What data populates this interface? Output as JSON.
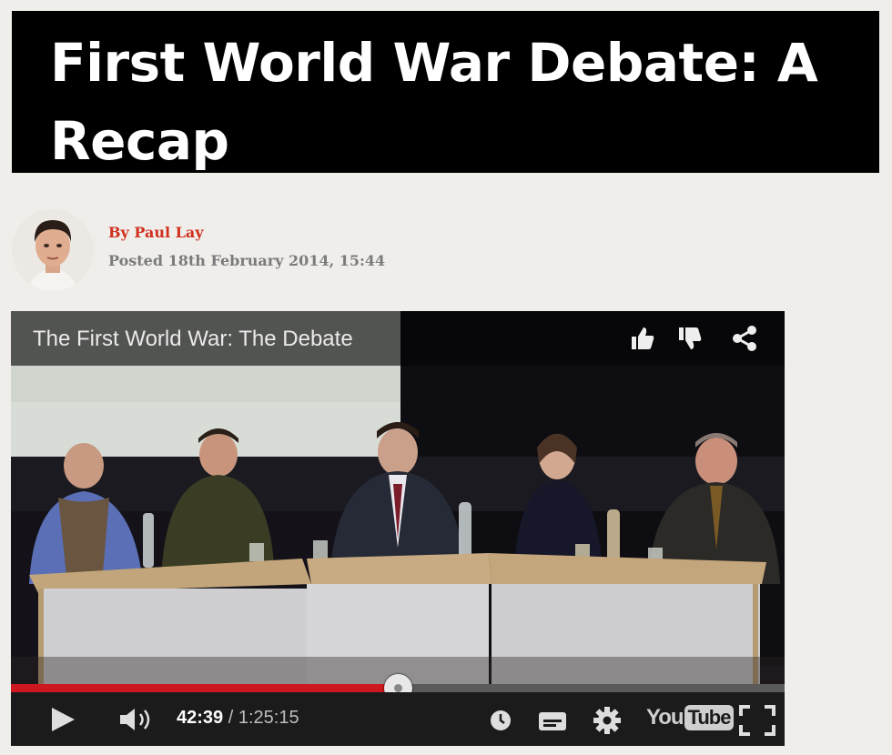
{
  "article": {
    "title": "First World War Debate: A Recap",
    "byline": "By Paul Lay",
    "posted": "Posted 18th February 2014, 15:44"
  },
  "video": {
    "title": "The First World War: The Debate",
    "current_time": "42:39",
    "separator": "/",
    "duration": "1:25:15",
    "progress_fraction": 0.5003,
    "logo_you": "You",
    "logo_tube": "Tube",
    "icons": {
      "like": "thumbs-up-icon",
      "dislike": "thumbs-down-icon",
      "share": "share-icon",
      "play": "play-icon",
      "volume": "volume-icon",
      "watch_later": "clock-icon",
      "captions": "captions-icon",
      "settings": "gear-icon",
      "fullscreen": "fullscreen-icon"
    }
  },
  "colors": {
    "accent_red": "#d0301d",
    "progress_red": "#cc181e",
    "title_bg": "#000000",
    "page_bg": "#f0eeeb"
  }
}
